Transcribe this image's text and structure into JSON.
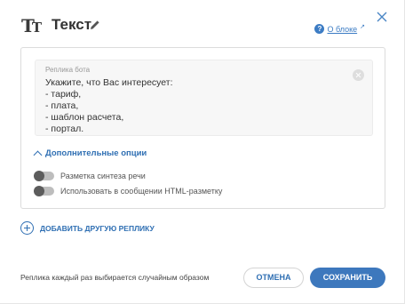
{
  "header": {
    "icon_big": "T",
    "icon_small": "T",
    "title": "Текст",
    "about_icon": "?",
    "about_link": "О блоке",
    "about_ext_icon": "↗"
  },
  "reply": {
    "label": "Реплика бота",
    "text": "Укажите, что Вас интересует:\n- тариф,\n- плата,\n- шаблон расчета,\n- портал."
  },
  "options": {
    "more_label": "Дополнительные опции",
    "toggles": [
      {
        "label": "Разметка синтеза речи",
        "on": false
      },
      {
        "label": "Использовать в сообщении HTML-разметку",
        "on": false
      }
    ]
  },
  "add_reply_label": "ДОБАВИТЬ ДРУГУЮ РЕПЛИКУ",
  "footer": {
    "note": "Реплика каждый раз выбирается случайным образом",
    "cancel_label": "ОТМЕНА",
    "save_label": "СОХРАНИТЬ"
  },
  "colors": {
    "accent": "#2f6fb3",
    "save_button": "#3d78bd"
  }
}
